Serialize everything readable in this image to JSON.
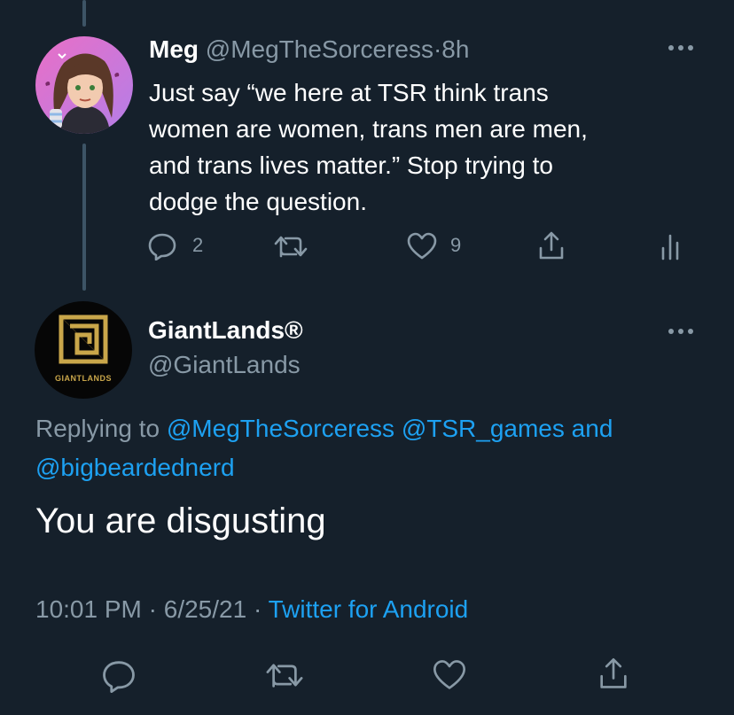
{
  "parent_tweet": {
    "display_name": "Meg",
    "handle": "@MegTheSorceress",
    "separator": "·",
    "time": "8h",
    "text_lines": [
      "Just say “we here at TSR think trans",
      "women are women, trans men are men,",
      "and trans lives matter.” Stop trying to",
      "dodge the question."
    ],
    "reply_count": "2",
    "retweet_count": "",
    "like_count": "9"
  },
  "main_tweet": {
    "display_name": "GiantLands®",
    "handle": "@GiantLands",
    "avatar_logo_text": "GIANTLANDS",
    "replying_prefix": "Replying to",
    "replying_users": [
      "@MegTheSorceress",
      "@TSR_games",
      "@bigbeardednerd"
    ],
    "replying_and": "and",
    "text": "You are disgusting",
    "time": "10:01 PM",
    "dot": "·",
    "date": "6/25/21",
    "source": "Twitter for Android"
  },
  "colors": {
    "background": "#15202b",
    "text": "#ffffff",
    "muted": "#8899a6",
    "link": "#1da1f2",
    "thread_line": "#3d5466",
    "avatar_gold": "#c9a64a"
  },
  "icons": [
    "more-icon",
    "reply-icon",
    "retweet-icon",
    "like-icon",
    "share-icon",
    "analytics-icon"
  ]
}
